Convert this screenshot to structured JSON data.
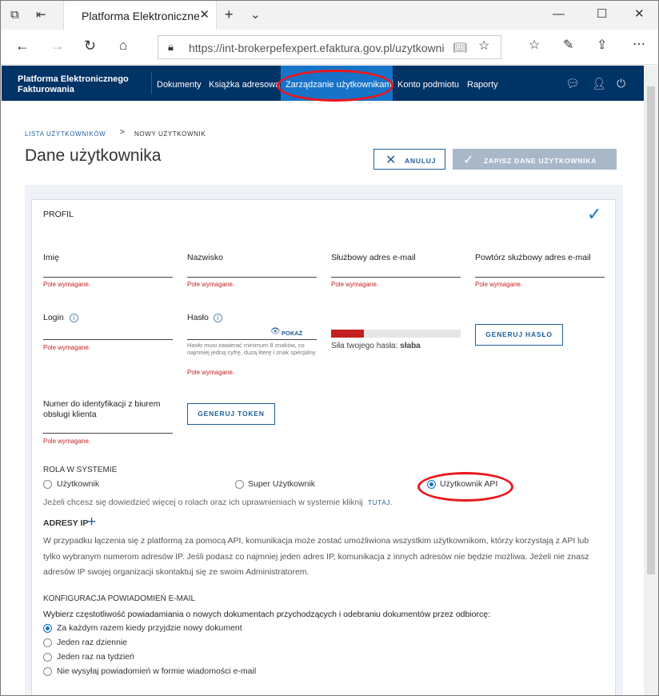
{
  "browser": {
    "tab_title": "Platforma Elektroniczne",
    "url": "https://int-brokerpefexpert.efaktura.gov.pl/uzytkownicy/"
  },
  "nav": {
    "brand": "Platforma Elektronicznego Fakturowania",
    "items": [
      "Dokumenty",
      "Książka adresowa",
      "Zarządzanie użytkownikami",
      "Konto podmiotu",
      "Raporty"
    ],
    "active_index": 2
  },
  "breadcrumb": {
    "parent": "LISTA UŻYTKOWNIKÓW",
    "separator": ">",
    "current": "NOWY UŻYTKOWNIK"
  },
  "page": {
    "title": "Dane użytkownika",
    "cancel_label": "ANULUJ",
    "save_label": "ZAPISZ DANE UŻYTKOWNIKA"
  },
  "profile": {
    "title": "PROFIL",
    "required": "Pole wymagane.",
    "first_name_label": "Imię",
    "last_name_label": "Nazwisko",
    "email_label": "Służbowy adres e-mail",
    "email_repeat_label": "Powtórz służbowy adres e-mail",
    "login_label": "Login",
    "password_label": "Hasło",
    "show_label": "POKAŻ",
    "password_hint": "Hasło musi zawierać minimum 8 znaków, co najmniej jedną cyfrę, dużą literę i znak specjalny",
    "strength_prefix": "Siła twojego hasła:",
    "strength_value": "słaba",
    "strength_fraction": 0.25,
    "generate_password_label": "GENERUJ HASŁO",
    "id_number_label": "Numer do identyfikacji z biurem obsługi klienta",
    "generate_token_label": "GENERUJ TOKEN"
  },
  "roles": {
    "title": "ROLA W SYSTEMIE",
    "options": [
      "Użytkownik",
      "Super Użytkownik",
      "Użytkownik API"
    ],
    "selected": 2,
    "hint": "Jeżeli chcesz się dowiedzieć więcej o rolach oraz ich uprawnieniach w systemie kliknij",
    "hint_link": "TUTAJ."
  },
  "ip": {
    "title": "ADRESY IP",
    "add_symbol": "+",
    "text": "W przypadku łączenia się z platformą za pomocą API, komunikacja może zostać umożliwiona wszystkim użytkownikom, którzy korzystają z API lub tylko wybranym numerom adresów IP. Jeśli podasz co najmniej jeden adres IP, komunikacja z innych adresów nie będzie możliwa. Jeżeli nie znasz adresów IP swojej organizacji skontaktuj się ze swoim Administratorem."
  },
  "notifications": {
    "title": "KONFIGURACJA POWIADOMIEŃ E-MAIL",
    "question": "Wybierz częstotliwość powiadamiania o nowych dokumentach przychodzących i odebraniu dokumentów przez odbiorcę:",
    "options": [
      "Za każdym razem kiedy przyjdzie nowy dokument",
      "Jeden raz dziennie",
      "Jeden raz na tydzień",
      "Nie wysyłaj powiadomień w formie wiadomości e-mail"
    ],
    "selected": 0
  },
  "colors": {
    "nav_bg": "#003366",
    "nav_active": "#1673c8",
    "accent": "#1f5f9a",
    "error": "#c41f1f",
    "annotation": "#e8171e"
  }
}
